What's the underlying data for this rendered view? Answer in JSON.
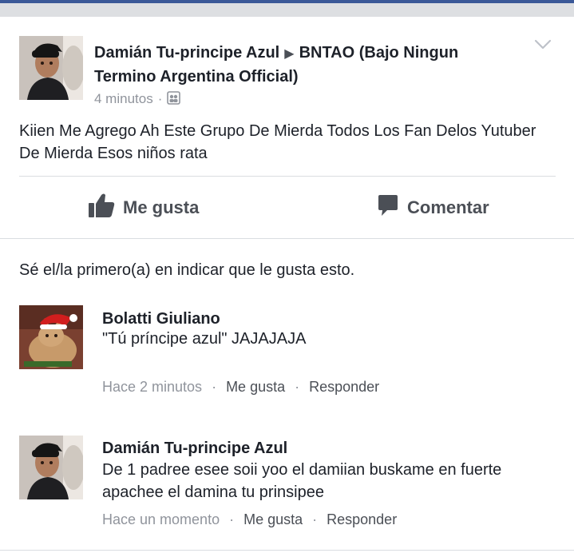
{
  "post": {
    "author": "Damián Tu-principe Azul",
    "group": "BNTAO (Bajo Ningun Termino Argentina Official)",
    "time": "4 minutos",
    "text": "Kiien Me Agrego Ah Este Grupo De Mierda Todos Los Fan Delos Yutuber De Mierda Esos niños rata"
  },
  "actions": {
    "like": "Me gusta",
    "comment": "Comentar"
  },
  "likes_prompt": "Sé el/la primero(a) en indicar que le gusta esto.",
  "comments": [
    {
      "name": "Bolatti Giuliano",
      "text": "\"Tú príncipe azul\" JAJAJAJA",
      "time": "Hace 2 minutos",
      "like": "Me gusta",
      "reply": "Responder"
    },
    {
      "name": "Damián Tu-principe Azul",
      "text": "De 1 padree esee soii yoo el damiian buskame en fuerte apachee el damina tu prinsipee",
      "time": "Hace un momento",
      "like": "Me gusta",
      "reply": "Responder"
    }
  ],
  "colors": {
    "brand": "#3b5998",
    "text": "#1d2129",
    "meta": "#90949c",
    "action": "#4b4f56"
  },
  "icons": {
    "group": "group-icon",
    "menu": "chevron-down-icon",
    "like": "thumbs-up-icon",
    "comment": "speech-bubble-icon"
  }
}
